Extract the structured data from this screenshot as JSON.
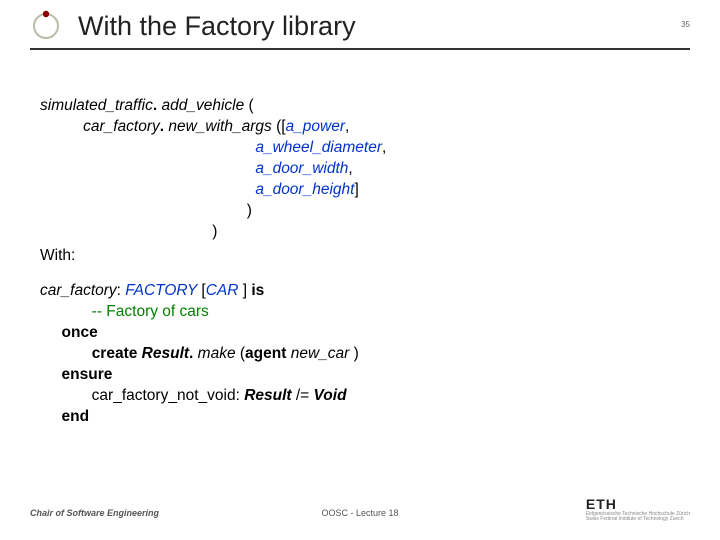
{
  "header": {
    "title": "With the Factory library",
    "page_number": "35"
  },
  "code1": {
    "l1a": "simulated_traffic",
    "l1b": ".",
    "l1c": " add_vehicle ",
    "l1d": "(",
    "l2a": "          ",
    "l2b": "car_factory",
    "l2c": ".",
    "l2d": " new_with_args ",
    "l2e": "([",
    "l2f": "a_power",
    "l2g": ",",
    "l3a": "                                                  ",
    "l3b": "a_wheel_diameter",
    "l3c": ",",
    "l4a": "                                                  ",
    "l4b": "a_door_width",
    "l4c": ",",
    "l5a": "                                                  ",
    "l5b": "a_door_height",
    "l5c": "]",
    "l6a": "                                                )",
    "l7a": "                                        )"
  },
  "with_label": "With:",
  "code2": {
    "l1a": "car_factory",
    "l1b": ": ",
    "l1c": "FACTORY ",
    "l1d": "[",
    "l1e": "CAR ",
    "l1f": "] ",
    "l1g": "is",
    "l2a": "            -- Factory of cars",
    "l3a": "     ",
    "l3b": "once",
    "l4a": "            ",
    "l4b": "create ",
    "l4c": "Result",
    "l4d": ".",
    "l4e": " make ",
    "l4f": "(",
    "l4g": "agent ",
    "l4h": "new_car ",
    "l4i": ")",
    "l5a": "     ",
    "l5b": "ensure",
    "l6a": "            car_factory_not_void: ",
    "l6b": "Result ",
    "l6c": "/= ",
    "l6d": "Void",
    "l7a": "     ",
    "l7b": "end"
  },
  "footer": {
    "left": "Chair of Software Engineering",
    "center": "OOSC - Lecture 18",
    "eth_big": "ETH",
    "eth_small1": "Eidgenössische Technische Hochschule Zürich",
    "eth_small2": "Swiss Federal Institute of Technology Zurich"
  }
}
